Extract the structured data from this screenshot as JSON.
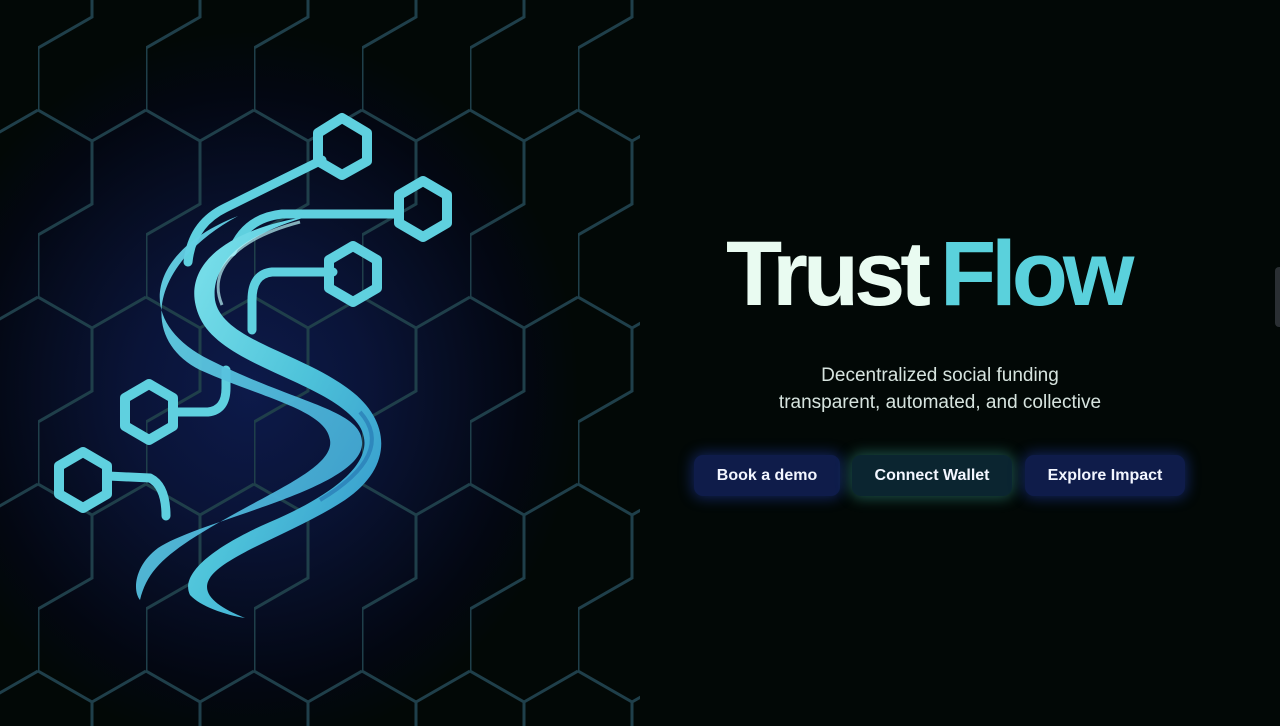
{
  "hero": {
    "brand_word_1": "Trust",
    "brand_word_2": "Flow",
    "tagline_line_1": "Decentralized social funding",
    "tagline_line_2": "transparent, automated, and collective"
  },
  "buttons": {
    "book_demo": "Book a demo",
    "connect_wallet": "Connect Wallet",
    "explore_impact": "Explore Impact"
  },
  "art": {
    "logo_icon": "trustflow-s-circuit-logo",
    "pattern": "hexagon-grid"
  },
  "colors": {
    "background": "#020806",
    "brand_light": "#e9fbf1",
    "brand_accent": "#5ad1dc",
    "grid_line": "#1f3f4a",
    "button_blue": "#0f1c4a",
    "button_teal": "#0b2530"
  }
}
